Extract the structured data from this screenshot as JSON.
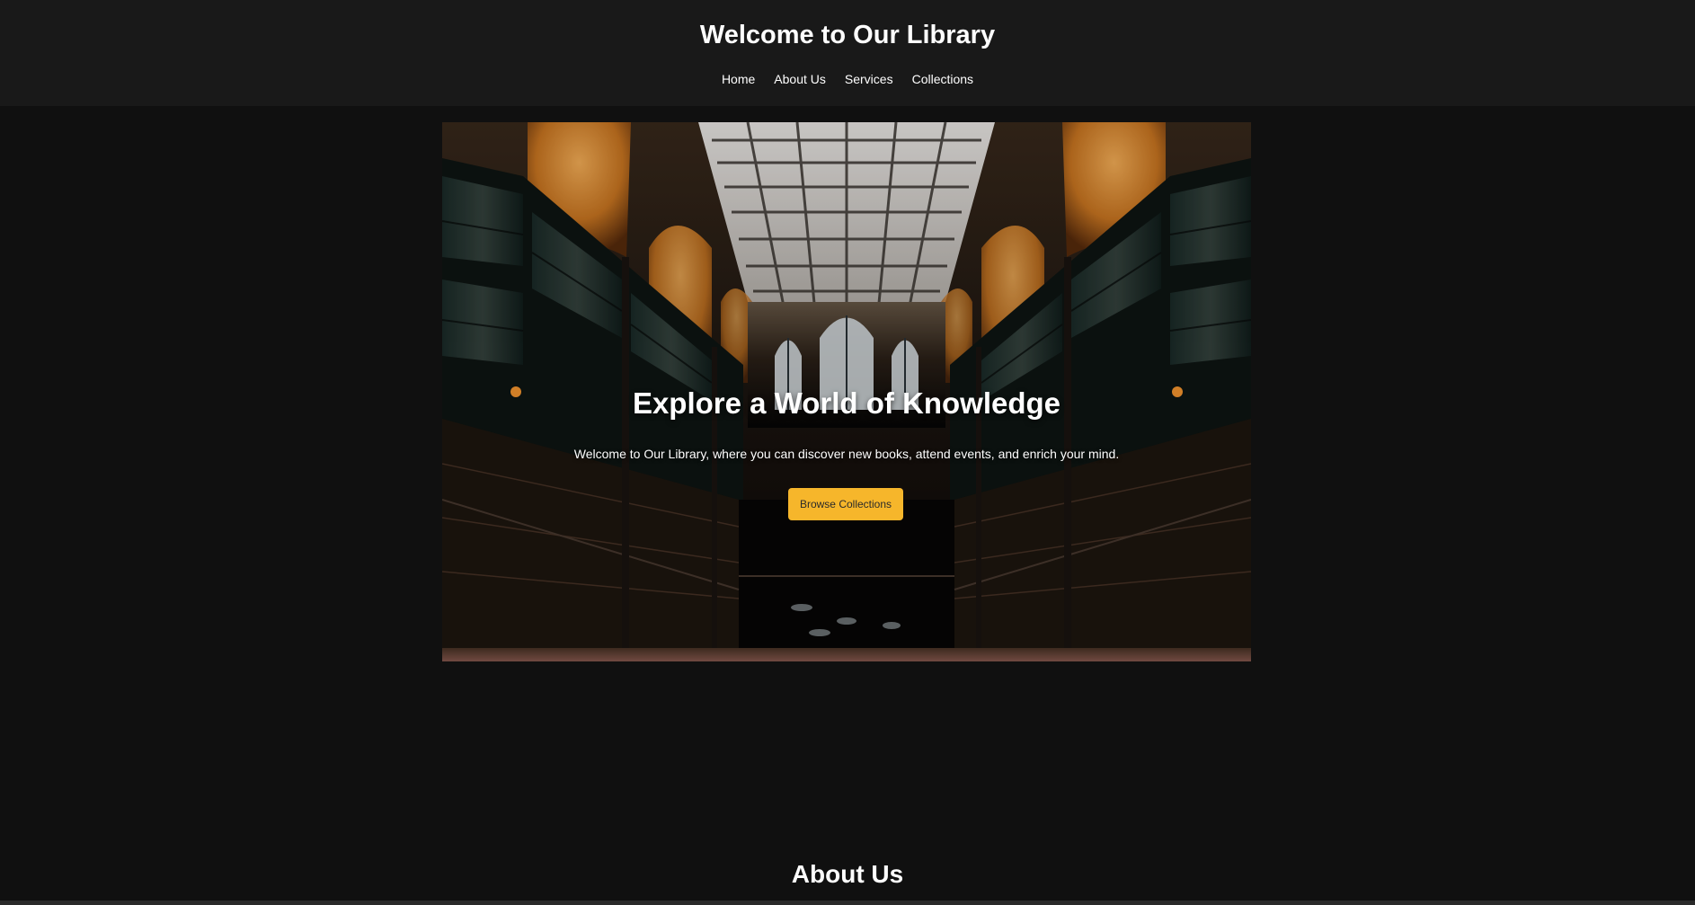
{
  "header": {
    "title": "Welcome to Our Library",
    "nav": [
      {
        "label": "Home"
      },
      {
        "label": "About Us"
      },
      {
        "label": "Services"
      },
      {
        "label": "Collections"
      }
    ]
  },
  "hero": {
    "image": "library-interior-photo",
    "title": "Explore a World of Knowledge",
    "subtitle": "Welcome to Our Library, where you can discover new books, attend events, and enrich your mind.",
    "cta_label": "Browse Collections"
  },
  "about": {
    "heading": "About Us"
  },
  "colors": {
    "page_background": "#101010",
    "header_background": "#191919",
    "accent": "#f6b62b",
    "text": "#ffffff"
  }
}
